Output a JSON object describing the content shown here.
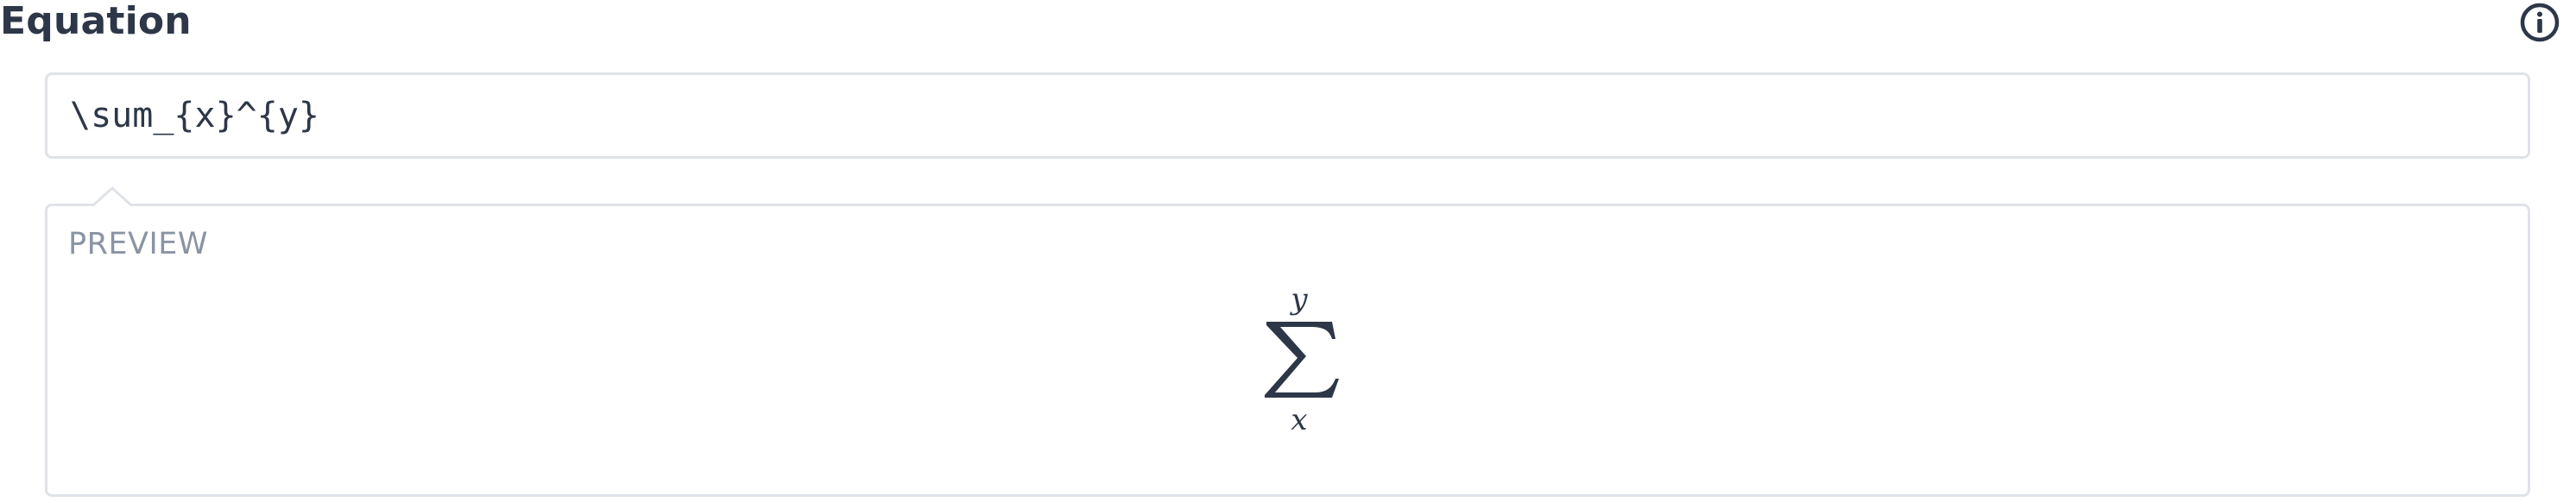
{
  "header": {
    "title": "Equation",
    "info_icon": "info-circle-icon"
  },
  "equation_input": {
    "value": "\\sum_{x}^{y}"
  },
  "preview": {
    "label": "PREVIEW",
    "rendered": {
      "operator": "Σ",
      "superscript": "y",
      "subscript": "x"
    }
  },
  "colors": {
    "text": "#2d3748",
    "border": "#dfe3e8",
    "muted_label": "#8a94a3"
  }
}
